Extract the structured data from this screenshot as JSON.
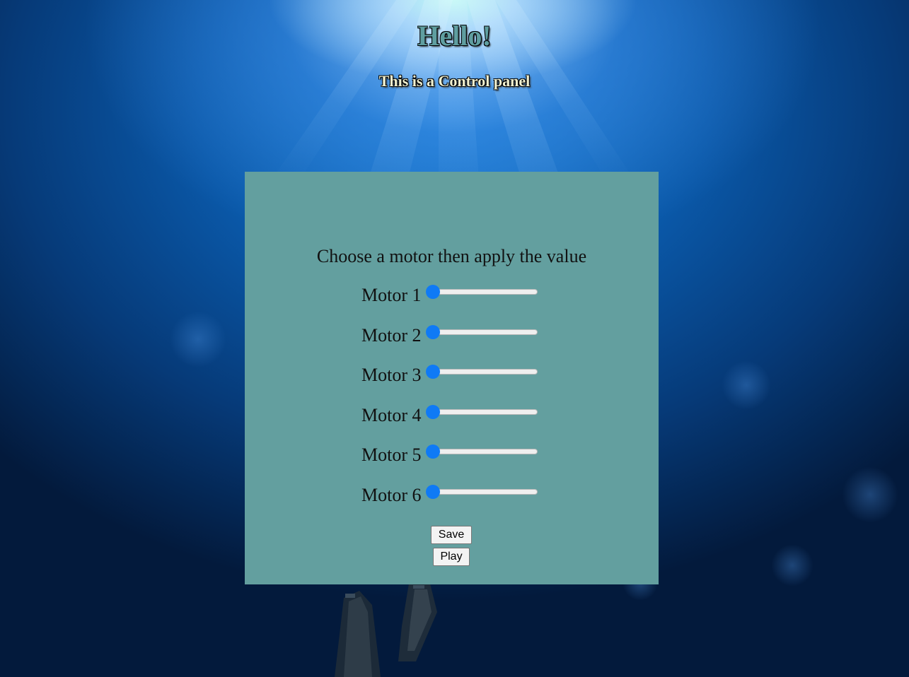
{
  "header": {
    "title": "Hello!",
    "subtitle": "This is a Control panel"
  },
  "panel": {
    "instructions": "Choose a motor then apply the value",
    "motors": [
      {
        "label": "Motor 1",
        "value": 0
      },
      {
        "label": "Motor 2",
        "value": 0
      },
      {
        "label": "Motor 3",
        "value": 0
      },
      {
        "label": "Motor 4",
        "value": 0
      },
      {
        "label": "Motor 5",
        "value": 0
      },
      {
        "label": "Motor 6",
        "value": 0
      }
    ],
    "save_label": "Save",
    "play_label": "Play"
  },
  "colors": {
    "panel_background": "#639f9f",
    "slider_thumb": "#0f7af5",
    "title_color": "#5f9ea0",
    "subtitle_color": "#f0f0d0"
  }
}
